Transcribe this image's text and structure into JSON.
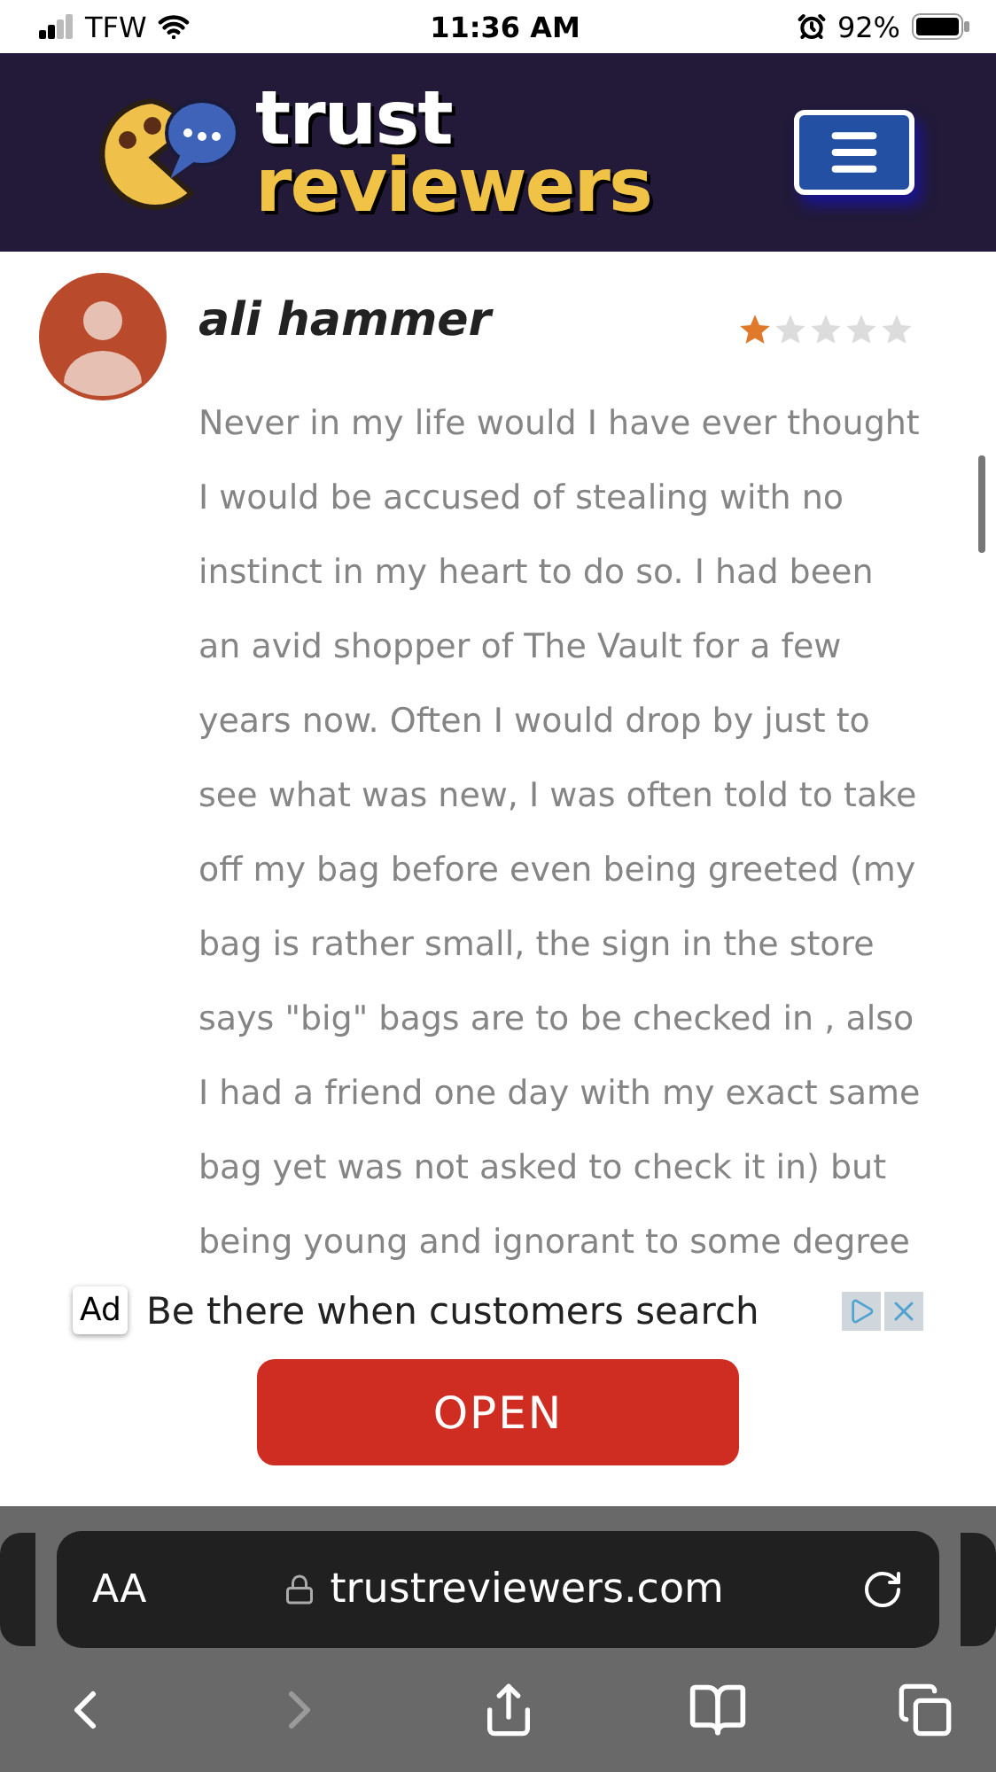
{
  "status_bar": {
    "carrier": "TFW",
    "time": "11:36 AM",
    "battery": "92%"
  },
  "header": {
    "logo_top": "trust",
    "logo_bottom": "reviewers"
  },
  "review": {
    "author": "ali hammer",
    "stars": 1,
    "lines": [
      "Never in my life would I have ever thought",
      "I would be accused of stealing with no",
      "instinct in my heart to do so. I had been",
      "an avid shopper of The Vault for a few",
      "years now. Often I would drop by just to",
      "see what was new, I was often told to take",
      "off my bag before even being greeted (my",
      "bag is rather small, the sign in the store",
      "says \"big\" bags are to be checked in , also",
      "I had a friend one day with my exact same",
      "bag yet was not asked to check it in) but",
      "being young and ignorant to some degree"
    ]
  },
  "ad": {
    "badge": "Ad",
    "headline": "Be there when customers search",
    "button": "OPEN"
  },
  "browser": {
    "text_size": "AA",
    "url": "trustreviewers.com"
  }
}
